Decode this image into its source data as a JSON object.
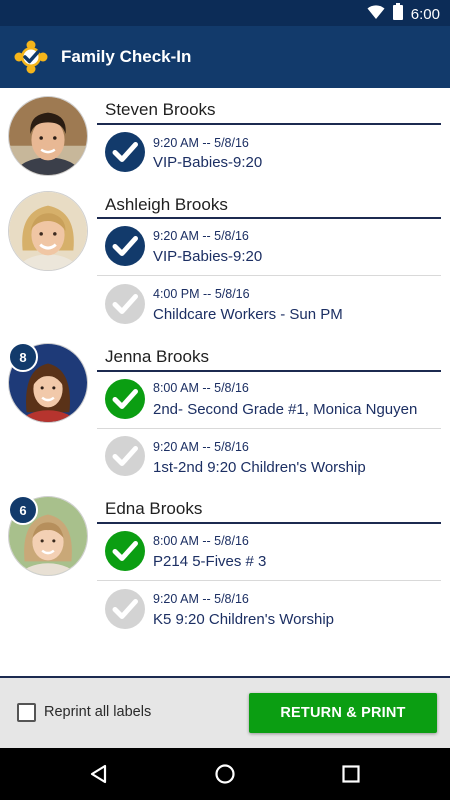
{
  "status_bar": {
    "time": "6:00"
  },
  "app_bar": {
    "title": "Family Check-In"
  },
  "people": [
    {
      "name": "Steven Brooks",
      "age_badge": "",
      "checkins": [
        {
          "time": "9:20 AM -- 5/8/16",
          "title": "VIP-Babies-9:20",
          "state": "checked"
        }
      ]
    },
    {
      "name": "Ashleigh Brooks",
      "age_badge": "",
      "checkins": [
        {
          "time": "9:20 AM -- 5/8/16",
          "title": "VIP-Babies-9:20",
          "state": "checked"
        },
        {
          "time": "4:00 PM -- 5/8/16",
          "title": "Childcare Workers - Sun PM",
          "state": "unchecked"
        }
      ]
    },
    {
      "name": "Jenna Brooks",
      "age_badge": "8",
      "checkins": [
        {
          "time": "8:00 AM -- 5/8/16",
          "title": "2nd- Second Grade #1, Monica Nguyen",
          "state": "selected"
        },
        {
          "time": "9:20 AM -- 5/8/16",
          "title": "1st-2nd 9:20 Children's Worship",
          "state": "unchecked"
        }
      ]
    },
    {
      "name": "Edna Brooks",
      "age_badge": "6",
      "checkins": [
        {
          "time": "8:00 AM -- 5/8/16",
          "title": "P214 5-Fives # 3",
          "state": "selected"
        },
        {
          "time": "9:20 AM -- 5/8/16",
          "title": "K5 9:20 Children's Worship",
          "state": "unchecked"
        }
      ]
    }
  ],
  "footer": {
    "reprint_label": "Reprint all labels",
    "reprint_checked": false,
    "print_button": "RETURN & PRINT"
  },
  "colors": {
    "header": "#123a6b",
    "status_bar": "#0c2c57",
    "checked": "#123a6b",
    "selected": "#0b9e12",
    "unchecked": "#d3d3d3",
    "print_button": "#0b9e12"
  },
  "icons": {
    "app_logo": "check-badge-icon",
    "checked": "check-circle-icon",
    "nav": [
      "back-icon",
      "home-icon",
      "recents-icon"
    ]
  }
}
